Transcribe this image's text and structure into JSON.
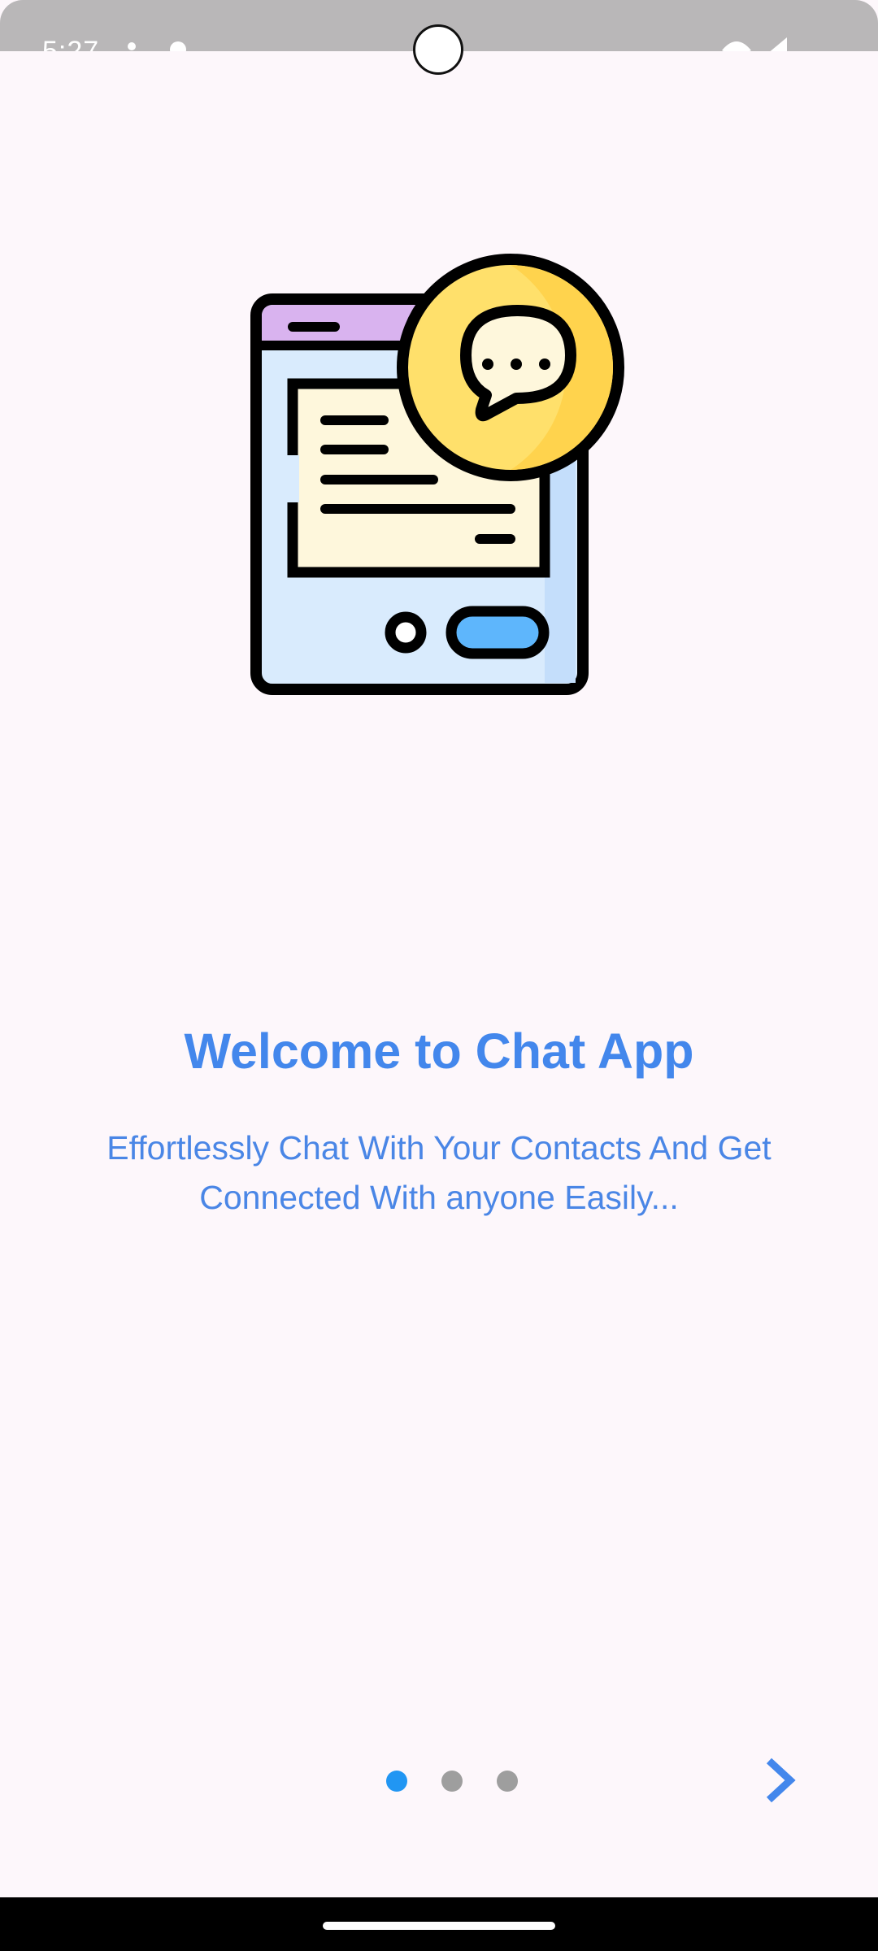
{
  "status_bar": {
    "time": "5:27"
  },
  "onboarding": {
    "title": "Welcome to Chat App",
    "subtitle": "Effortlessly Chat With Your Contacts And Get Connected With anyone Easily...",
    "page_count": 3,
    "current_page": 1
  },
  "colors": {
    "accent": "#4387ec",
    "dot_active": "#2196f3",
    "dot_inactive": "#9e9e9e",
    "background": "#fdf7fb"
  },
  "icons": {
    "illustration": "chat-window-illustration-icon",
    "next": "chevron-right-icon"
  }
}
